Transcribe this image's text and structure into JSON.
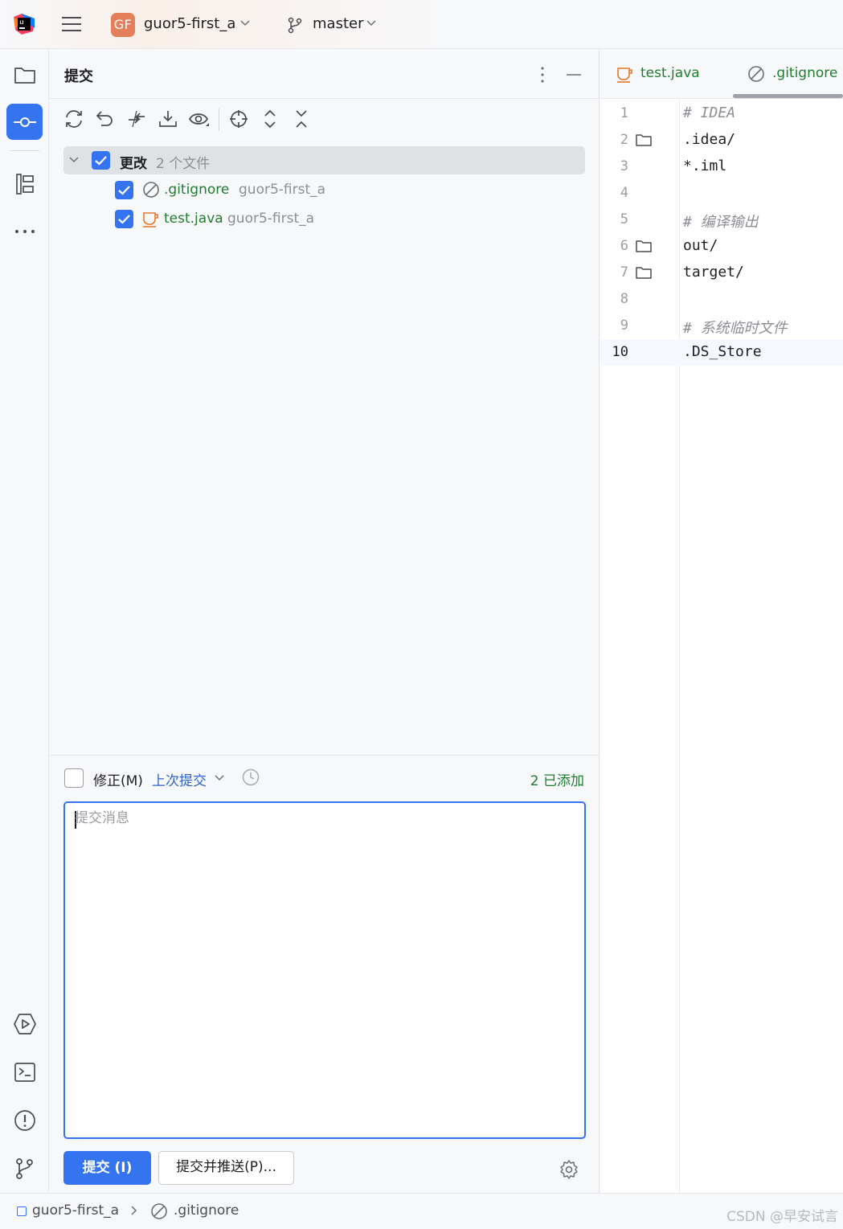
{
  "topbar": {
    "project_badge": "GF",
    "project_name": "guor5-first_a",
    "branch": "master"
  },
  "sidebar": {
    "items": [
      {
        "icon": "folder-icon"
      },
      {
        "icon": "commit-icon",
        "active": true
      },
      {
        "icon": "structure-icon"
      },
      {
        "icon": "more-icon"
      },
      {
        "icon": "run-icon"
      },
      {
        "icon": "terminal-icon"
      },
      {
        "icon": "problems-icon"
      },
      {
        "icon": "git-icon"
      }
    ]
  },
  "commit_panel": {
    "title": "提交",
    "group": {
      "label": "更改",
      "count": "2 个文件"
    },
    "files": [
      {
        "name": ".gitignore",
        "path": "guor5-first_a",
        "icon": "ignore-icon"
      },
      {
        "name": "test.java",
        "path": "guor5-first_a",
        "icon": "java-icon"
      }
    ],
    "amend_label": "修正(M)",
    "last_commit_link": "上次提交",
    "added_status": "2 已添加",
    "message_placeholder": "提交消息",
    "commit_button": "提交 (I)",
    "commit_push_button": "提交并推送(P)..."
  },
  "editor": {
    "tabs": [
      {
        "label": "test.java",
        "icon": "java-icon"
      },
      {
        "label": ".gitignore",
        "icon": "ignore-icon",
        "active": true
      }
    ],
    "lines": [
      {
        "n": "1",
        "text": "# IDEA",
        "comment": true,
        "folder": false
      },
      {
        "n": "2",
        "text": ".idea/",
        "comment": false,
        "folder": true
      },
      {
        "n": "3",
        "text": "*.iml",
        "comment": false,
        "folder": false
      },
      {
        "n": "4",
        "text": "",
        "comment": false,
        "folder": false
      },
      {
        "n": "5",
        "text": "# 编译输出",
        "comment": true,
        "folder": false
      },
      {
        "n": "6",
        "text": "out/",
        "comment": false,
        "folder": true
      },
      {
        "n": "7",
        "text": "target/",
        "comment": false,
        "folder": true
      },
      {
        "n": "8",
        "text": "",
        "comment": false,
        "folder": false
      },
      {
        "n": "9",
        "text": "# 系统临时文件",
        "comment": true,
        "folder": false
      },
      {
        "n": "10",
        "text": ".DS_Store",
        "comment": false,
        "folder": false,
        "current": true
      }
    ]
  },
  "statusbar": {
    "project": "guor5-first_a",
    "file": ".gitignore",
    "watermark": "CSDN @早安试言"
  },
  "colors": {
    "accent": "#3574f0",
    "added_green": "#1f7d2f",
    "link_blue": "#2f62c9",
    "badge_orange": "#e57f5b"
  }
}
